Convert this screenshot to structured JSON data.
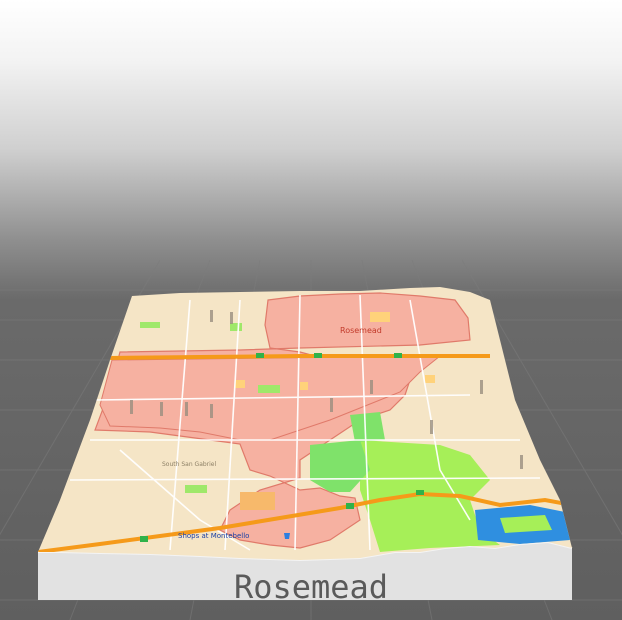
{
  "viewer": {
    "model_label": "Rosemead"
  },
  "map": {
    "place_name": "Rosemead",
    "labels": {
      "south_san_gabriel": "South San Gabriel",
      "shopping_center": "Shops at Montebello"
    },
    "colors": {
      "land": "#f6e6c8",
      "city_area": "#f7b3a4",
      "city_border": "#e07a6a",
      "park": "#7fe36a",
      "park_light": "#a6f05a",
      "water": "#2f8fe0",
      "freeway": "#f59a1a",
      "freeway_shield": "#2fb24a",
      "plinth": "#e6e6e6",
      "plinth_side": "#d4d4d4"
    },
    "icons": [
      "highway-shield-icon",
      "shopping-bag-icon"
    ]
  }
}
